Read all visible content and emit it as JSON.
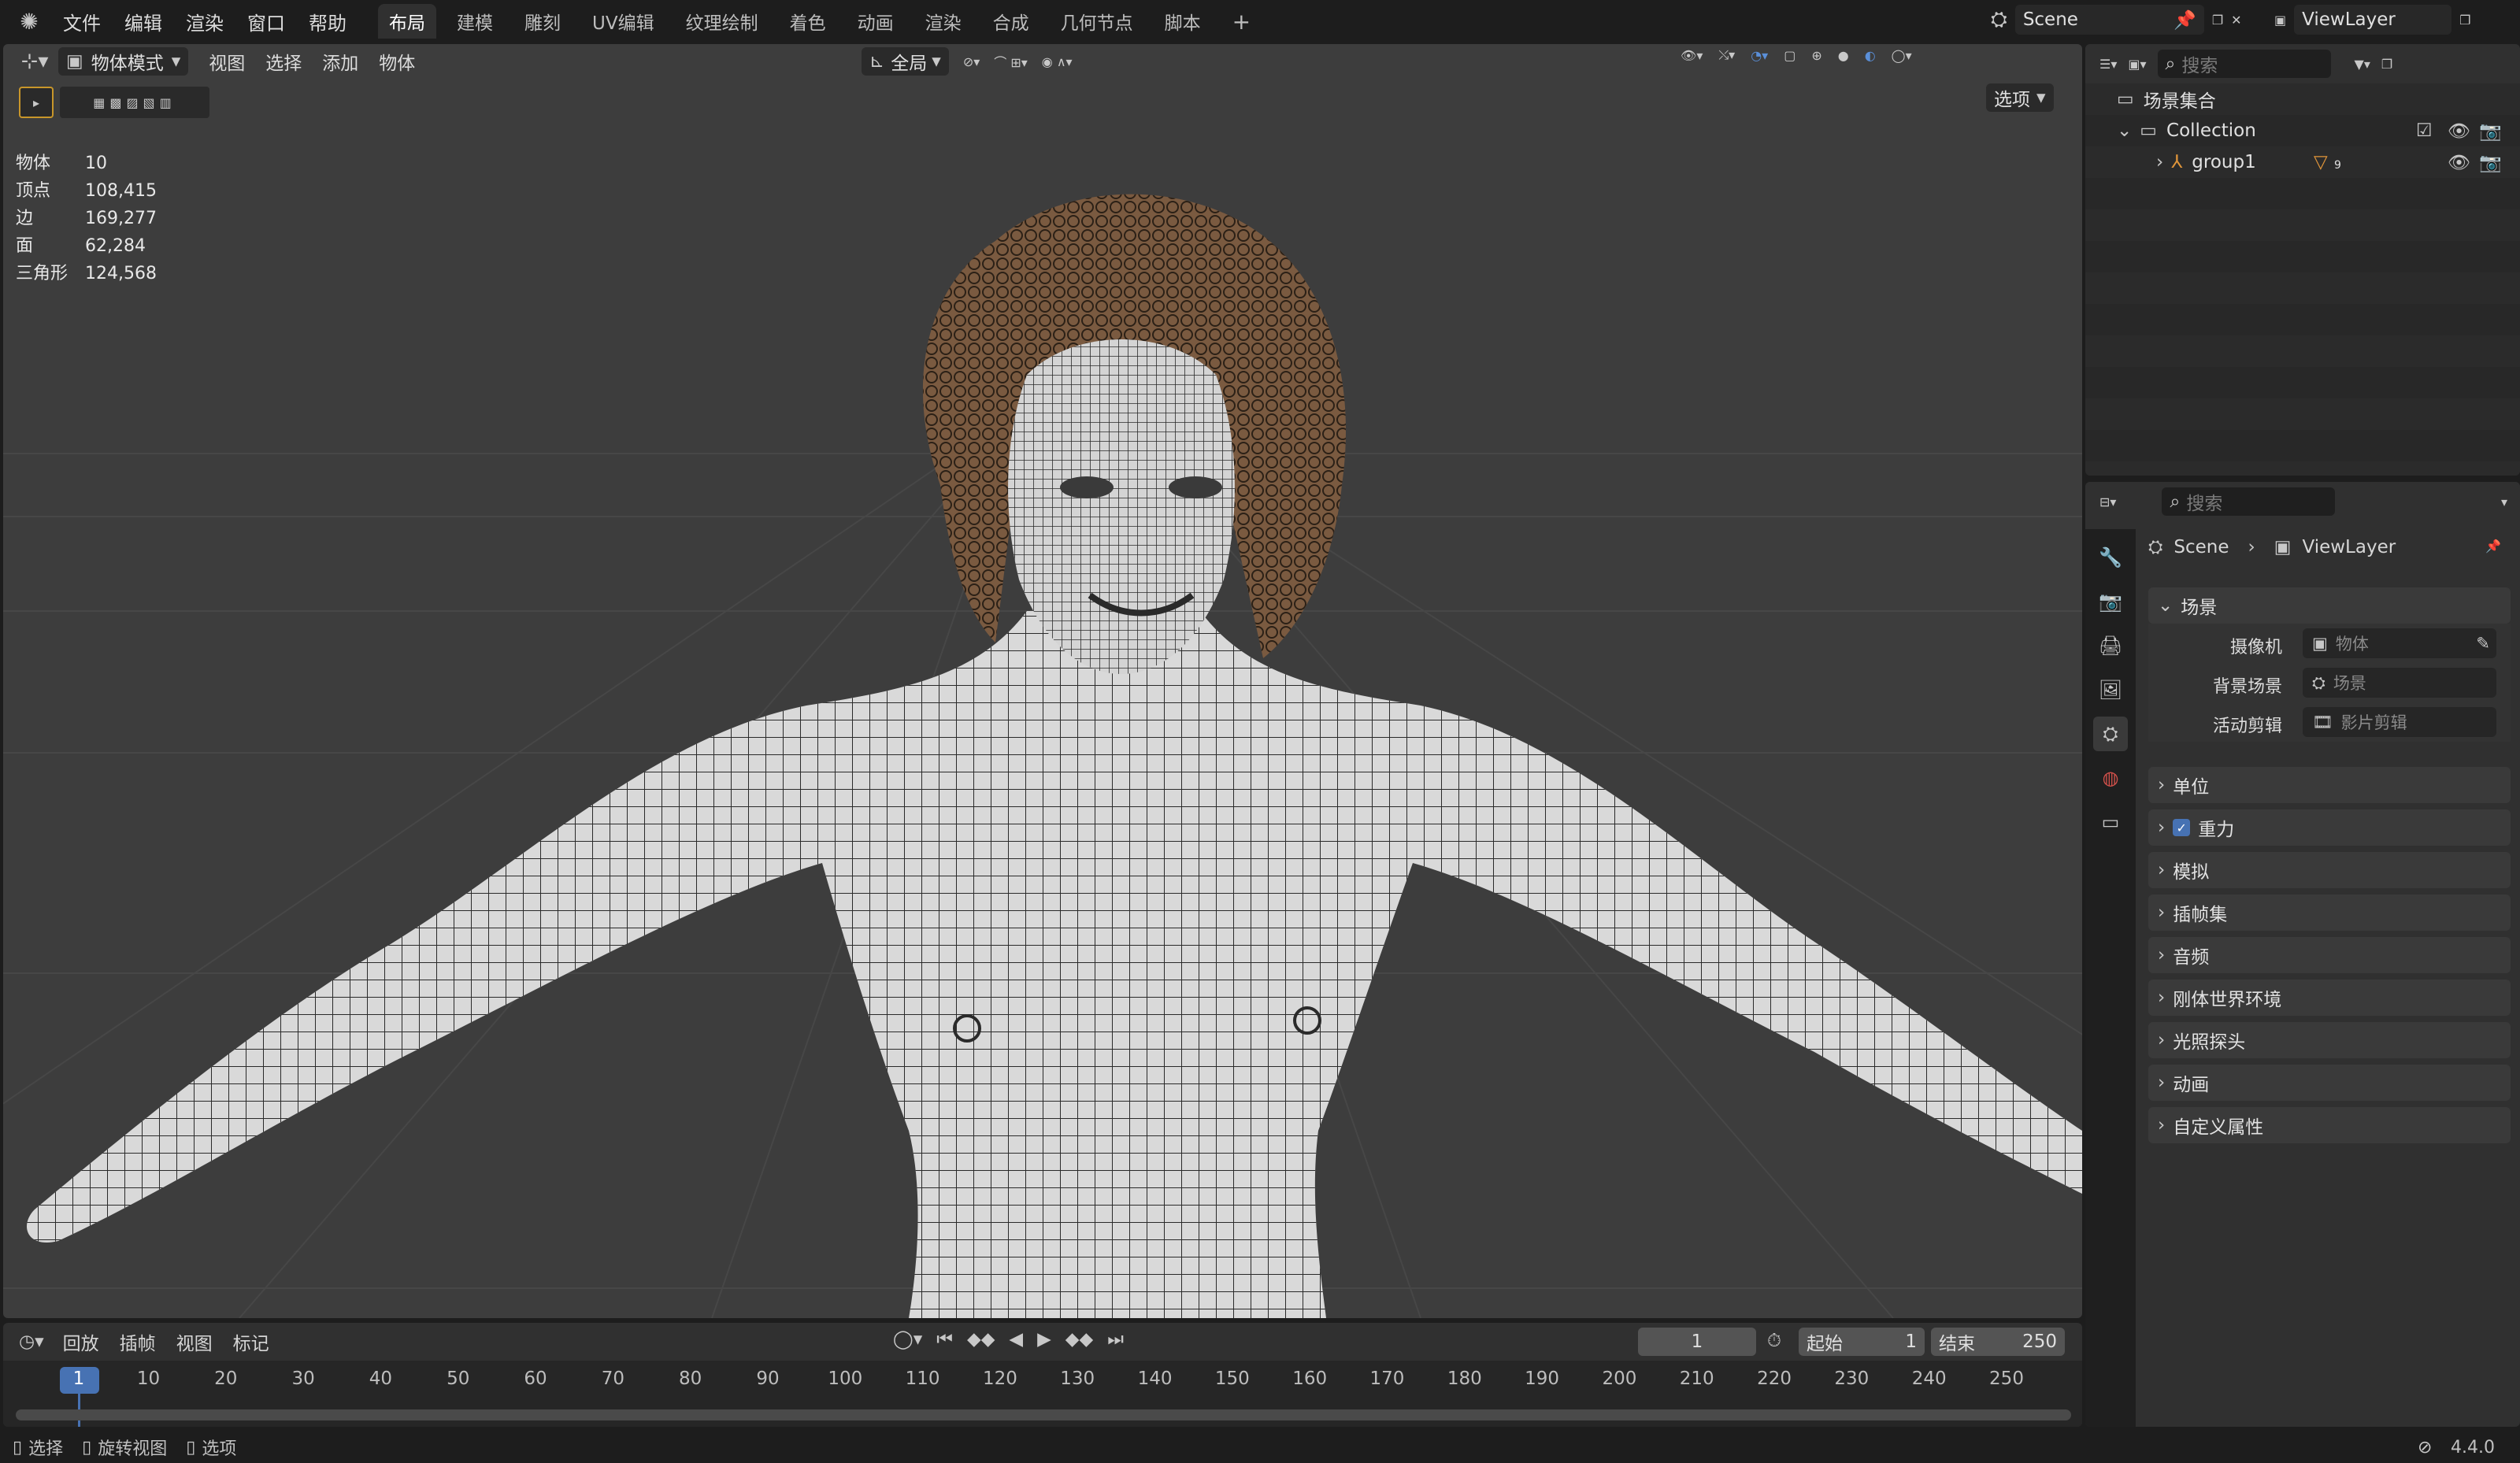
{
  "topbar": {
    "menus": [
      "文件",
      "编辑",
      "渲染",
      "窗口",
      "帮助"
    ],
    "workspace_tabs": [
      "布局",
      "建模",
      "雕刻",
      "UV编辑",
      "纹理绘制",
      "着色",
      "动画",
      "渲染",
      "合成",
      "几何节点",
      "脚本"
    ],
    "add_tab": "+",
    "scene_name": "Scene",
    "view_layer_name": "ViewLayer"
  },
  "viewport_header": {
    "mode": "物体模式",
    "menus": [
      "视图",
      "选择",
      "添加",
      "物体"
    ],
    "transform_orientation": "全局",
    "options_label": "选项"
  },
  "stats": [
    {
      "label": "物体",
      "value": "10"
    },
    {
      "label": "顶点",
      "value": "108,415"
    },
    {
      "label": "边",
      "value": "169,277"
    },
    {
      "label": "面",
      "value": "62,284"
    },
    {
      "label": "三角形",
      "value": "124,568"
    }
  ],
  "outliner": {
    "search_placeholder": "搜索",
    "root": "场景集合",
    "collection": "Collection",
    "object": "group1",
    "object_badge": "9"
  },
  "properties": {
    "search_placeholder": "搜索",
    "breadcrumb_scene": "Scene",
    "breadcrumb_layer": "ViewLayer",
    "scene_panel": "场景",
    "camera_label": "摄像机",
    "camera_placeholder": "物体",
    "bg_scene_label": "背景场景",
    "bg_scene_placeholder": "场景",
    "active_clip_label": "活动剪辑",
    "active_clip_placeholder": "影片剪辑",
    "panels": [
      "单位",
      "重力",
      "模拟",
      "插帧集",
      "音频",
      "刚体世界环境",
      "光照探头",
      "动画",
      "自定义属性"
    ]
  },
  "timeline": {
    "menus": [
      "回放",
      "插帧",
      "视图",
      "标记"
    ],
    "current_frame": "1",
    "start_label": "起始",
    "start_value": "1",
    "end_label": "结束",
    "end_value": "250",
    "ruler": [
      "1",
      "10",
      "20",
      "30",
      "40",
      "50",
      "60",
      "70",
      "80",
      "90",
      "100",
      "110",
      "120",
      "130",
      "140",
      "150",
      "160",
      "170",
      "180",
      "190",
      "200",
      "210",
      "220",
      "230",
      "240",
      "250"
    ]
  },
  "statusbar": {
    "select": "选择",
    "rotate": "旋转视图",
    "options": "选项",
    "version": "4.4.0"
  },
  "colors": {
    "accent": "#4772b3",
    "viewport_bg": "#3d3d3d",
    "hair": "#7a5a40"
  }
}
